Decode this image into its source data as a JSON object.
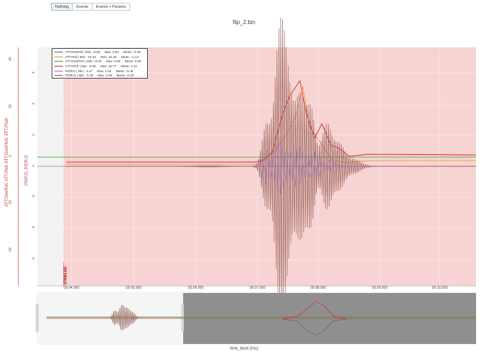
{
  "toolbar": {
    "buttons": [
      "Nothing",
      "Events",
      "Events + Params"
    ],
    "active": 0
  },
  "title": "flip_2.bin",
  "axis": {
    "xlabel": "time_boot (ms)",
    "ylabel_left": "ATT.DesRoll, ATT.Roll, ATT.DesPitch, ATT.Pitch",
    "ylabel_right": "PIDP.D, PIDR.D",
    "left_ticks": [
      "40",
      "20",
      "0",
      "-20",
      "-40"
    ],
    "right_ticks": [
      "4",
      "3",
      "2",
      "1",
      "0",
      "-1",
      "-2",
      "-3",
      "-4"
    ],
    "x_ticks": [
      "05:04.000",
      "05:05.000",
      "05:06.000",
      "05:07.000",
      "05:08.000",
      "05:09.000",
      "05:10.000"
    ]
  },
  "legend": [
    {
      "text": "ATT.DesRoll | Min: -0.00     Max: 0.00     Mean: -0.00",
      "color": "#1f6fb4"
    },
    {
      "text": "ATT.Roll | Min: -10.42     Max: 32.20     Mean: -1.13",
      "color": "#f08a2c"
    },
    {
      "text": "ATT.DesPitch | Min: -0.00     Max: 0.00     Mean: 0.00",
      "color": "#2ca02c"
    },
    {
      "text": "ATT.Pitch | Min: -3.05     Max: 32.77     Mean: 1.21",
      "color": "#d62728"
    },
    {
      "text": "PIDP.D | Min: -2.47     Max: 1.54     Mean: -0.00",
      "color": "#9467bd"
    },
    {
      "text": "PIDR.D | Min: -3.49     Max: 3.49     Mean: -0.00",
      "color": "#8c564b"
    }
  ],
  "event_marker": "STABILIZE",
  "colors": {
    "mode_band": "#f7d3d3",
    "prearm_band": "#f2f2f2",
    "range_shade": "#8f8f8f"
  }
}
